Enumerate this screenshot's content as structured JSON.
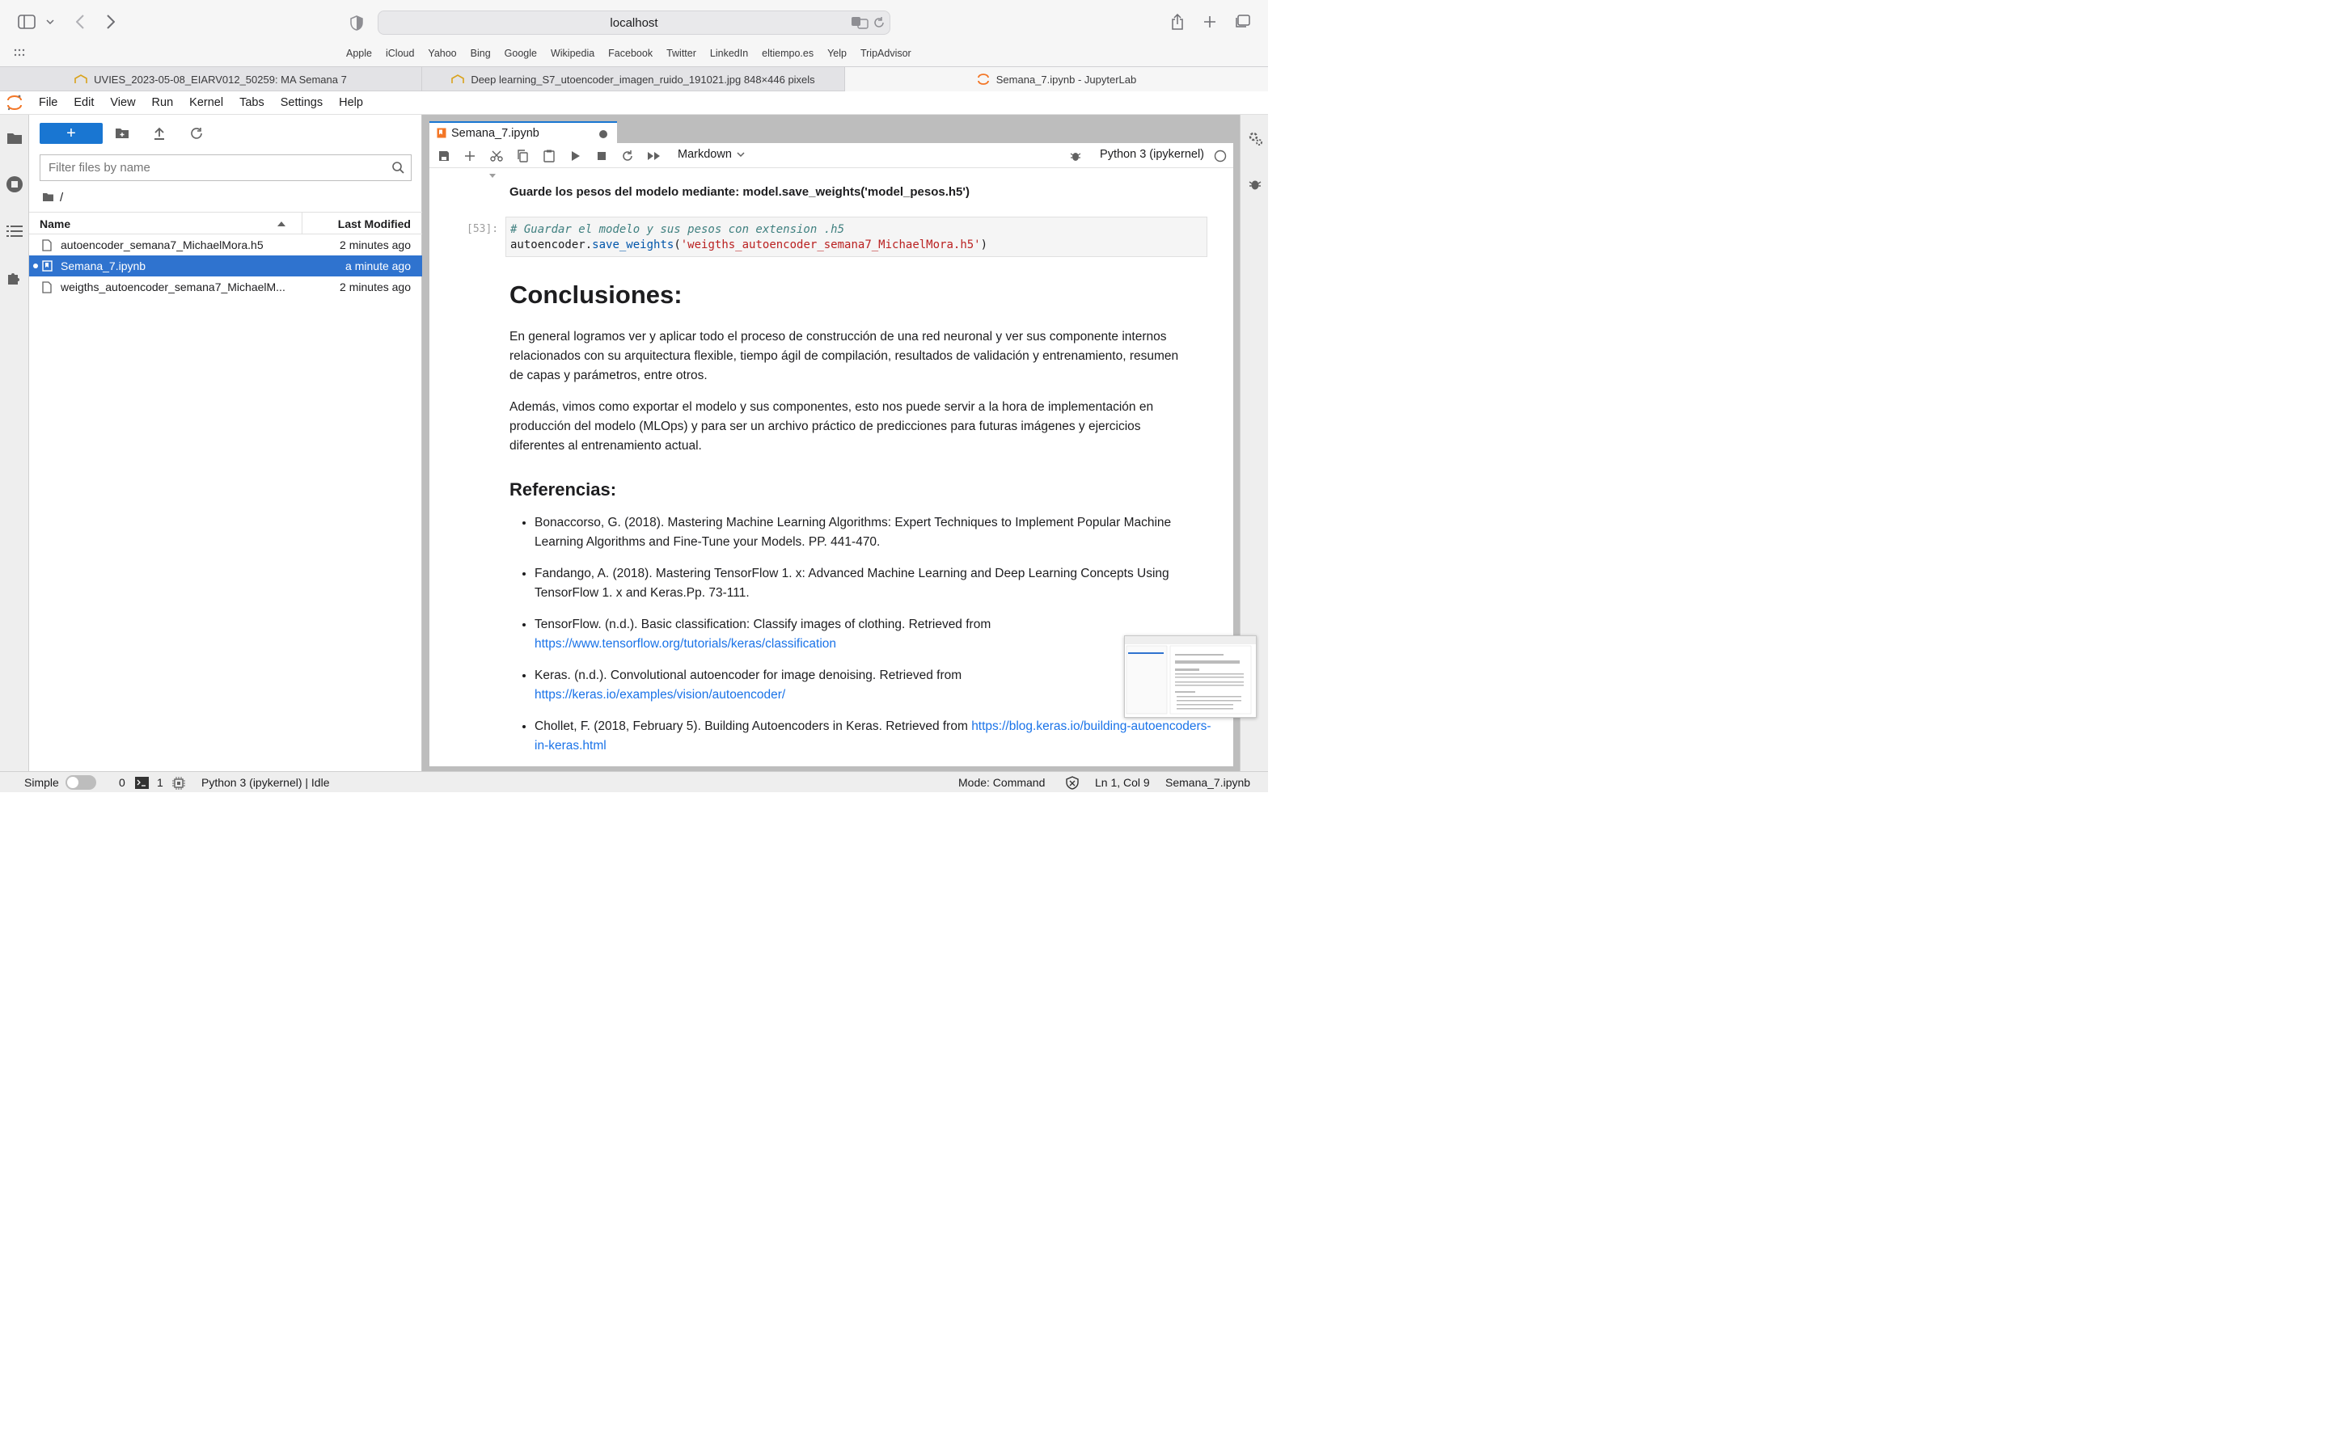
{
  "browser": {
    "address": "localhost",
    "favorites": [
      "Apple",
      "iCloud",
      "Yahoo",
      "Bing",
      "Google",
      "Wikipedia",
      "Facebook",
      "Twitter",
      "LinkedIn",
      "eltiempo.es",
      "Yelp",
      "TripAdvisor"
    ],
    "tabs": [
      {
        "title": "UVIES_2023-05-08_EIARV012_50259: MA Semana 7"
      },
      {
        "title": "Deep learning_S7_utoencoder_imagen_ruido_191021.jpg 848×446 pixels"
      },
      {
        "title": "Semana_7.ipynb - JupyterLab"
      }
    ]
  },
  "menubar": [
    "File",
    "Edit",
    "View",
    "Run",
    "Kernel",
    "Tabs",
    "Settings",
    "Help"
  ],
  "filebrowser": {
    "new_label": "+",
    "filter_placeholder": "Filter files by name",
    "path": "/",
    "col_name": "Name",
    "col_modified": "Last Modified",
    "files": [
      {
        "name": "autoencoder_semana7_MichaelMora.h5",
        "modified": "2 minutes ago"
      },
      {
        "name": "Semana_7.ipynb",
        "modified": "a minute ago"
      },
      {
        "name": "weigths_autoencoder_semana7_MichaelM...",
        "modified": "2 minutes ago"
      }
    ]
  },
  "notebook": {
    "tab_title": "Semana_7.ipynb",
    "cell_type": "Markdown",
    "kernel": "Python 3 (ipykernel)",
    "save_weights_heading": "Guarde los pesos del modelo mediante: model.save_weights('model_pesos.h5')",
    "prompt": "[53]:",
    "code_comment": "# Guardar el modelo y sus pesos con extension .h5",
    "code_obj": "autoencoder.",
    "code_fn": "save_weights",
    "code_open": "(",
    "code_str": "'weigths_autoencoder_semana7_MichaelMora.h5'",
    "code_close": ")",
    "conclusions_title": "Conclusiones:",
    "conclusions_p1": "En general logramos ver y aplicar todo el proceso de construcción de una red neuronal y ver sus componente internos relacionados con su arquitectura flexible, tiempo ágil de compilación, resultados de validación y entrenamiento, resumen de capas y parámetros, entre otros.",
    "conclusions_p2": "Además, vimos como exportar el modelo y sus componentes, esto nos puede servir a la hora de implementación en producción del modelo (MLOps) y para ser un archivo práctico de predicciones para futuras imágenes y ejercicios diferentes al entrenamiento actual.",
    "references_title": "Referencias:",
    "references": [
      {
        "text": "Bonaccorso, G. (2018). Mastering Machine Learning Algorithms: Expert Techniques to Implement Popular Machine Learning Algorithms and Fine-Tune your Models. PP. 441-470.",
        "link": ""
      },
      {
        "text": "Fandango, A. (2018). Mastering TensorFlow 1. x: Advanced Machine Learning and Deep Learning Concepts Using TensorFlow 1. x and Keras.Pp. 73-111.",
        "link": ""
      },
      {
        "text": "TensorFlow. (n.d.). Basic classification: Classify images of clothing. Retrieved from ",
        "link": "https://www.tensorflow.org/tutorials/keras/classification"
      },
      {
        "text": "Keras. (n.d.). Convolutional autoencoder for image denoising. Retrieved from ",
        "link": "https://keras.io/examples/vision/autoencoder/"
      },
      {
        "text": "Chollet, F. (2018, February 5). Building Autoencoders in Keras. Retrieved from ",
        "link": "https://blog.keras.io/building-autoencoders-in-keras.html"
      }
    ]
  },
  "statusbar": {
    "mode_label": "Simple",
    "terminals": "0",
    "kernels": "1",
    "kernel_status": "Python 3 (ipykernel) | Idle",
    "mode": "Mode: Command",
    "position": "Ln 1, Col 9",
    "filename": "Semana_7.ipynb"
  },
  "colors": {
    "accent": "#1976d2",
    "selection": "#2f73cf",
    "link": "#1a73e8"
  }
}
